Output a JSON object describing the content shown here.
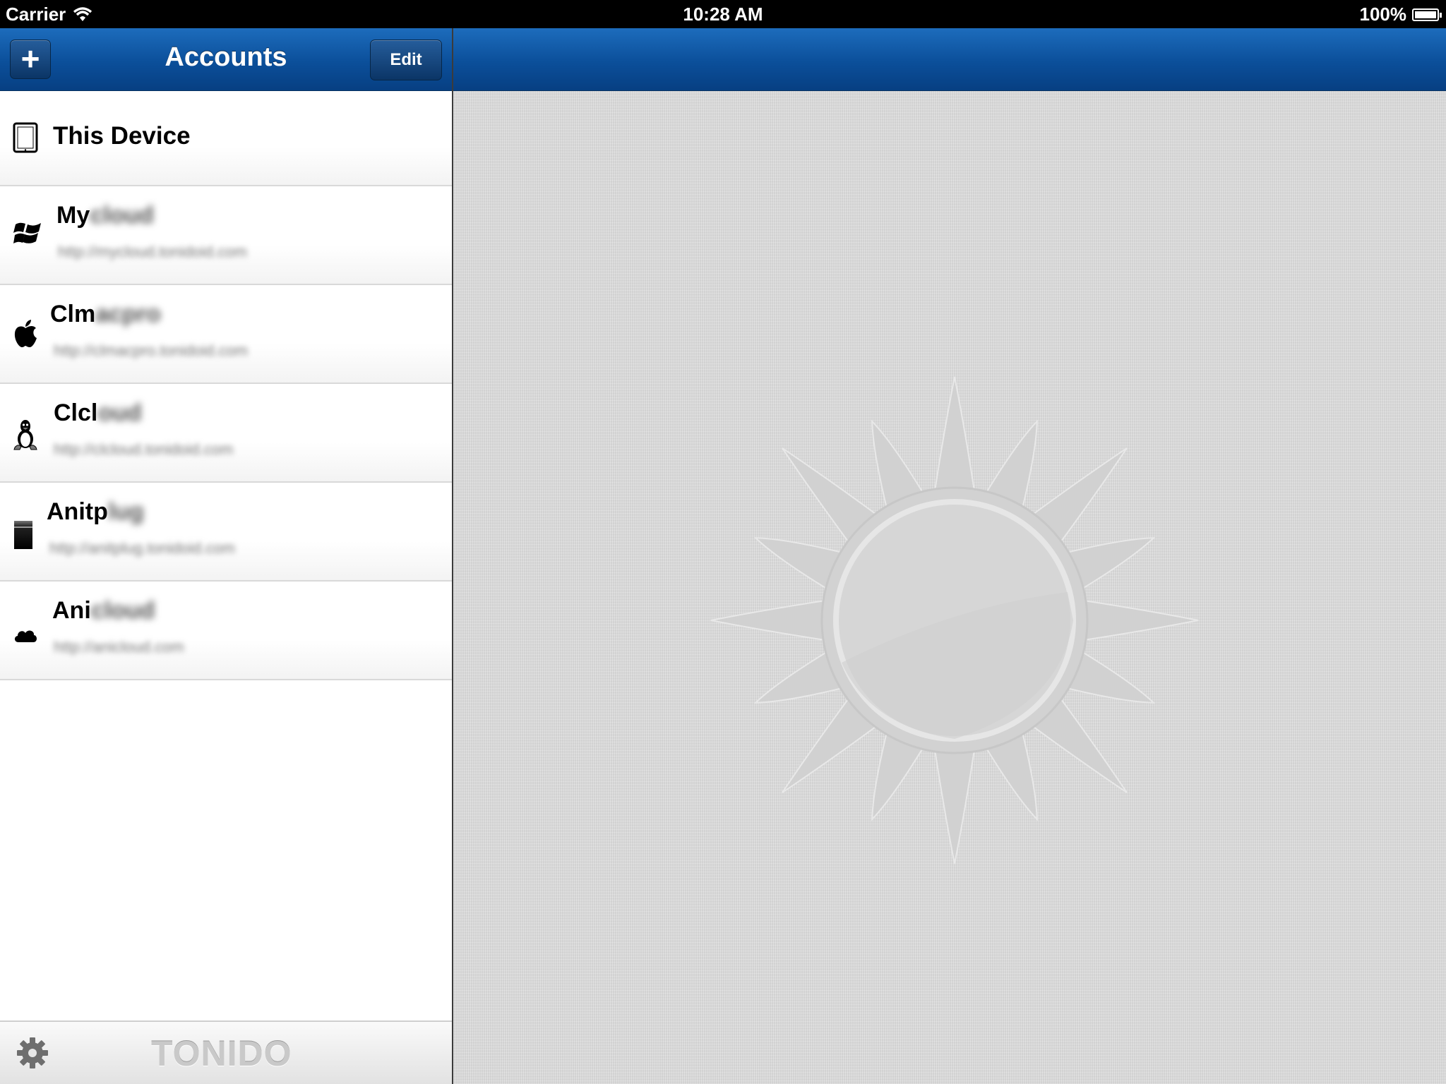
{
  "status_bar": {
    "carrier": "Carrier",
    "time": "10:28 AM",
    "battery": "100%",
    "battery_level": 1.0
  },
  "master": {
    "title": "Accounts",
    "add_label": "+",
    "edit_label": "Edit",
    "accounts": [
      {
        "kind": "device",
        "icon": "tablet-icon",
        "name": "This Device",
        "name_hidden": "",
        "url": ""
      },
      {
        "kind": "server",
        "icon": "windows-icon",
        "name": "My",
        "name_hidden": "cloud",
        "url": "http://mycloud.tonidoid.com"
      },
      {
        "kind": "server",
        "icon": "apple-icon",
        "name": "Clm",
        "name_hidden": "acpro",
        "url": "http://clmacpro.tonidoid.com"
      },
      {
        "kind": "server",
        "icon": "linux-icon",
        "name": "Clcl",
        "name_hidden": "oud",
        "url": "http://clcloud.tonidoid.com"
      },
      {
        "kind": "server",
        "icon": "plug-server-icon",
        "name": "Anitp",
        "name_hidden": "lug",
        "url": "http://anitplug.tonidoid.com"
      },
      {
        "kind": "server",
        "icon": "cloud-icon",
        "name": "Ani",
        "name_hidden": "cloud",
        "url": "http://anicloud.com"
      }
    ]
  },
  "bottom_bar": {
    "settings_icon": "gear-icon",
    "brand": "TONIDO"
  },
  "colors": {
    "nav_blue_top": "#1d6cbc",
    "nav_blue_bottom": "#073f82",
    "linen": "#dadada"
  }
}
